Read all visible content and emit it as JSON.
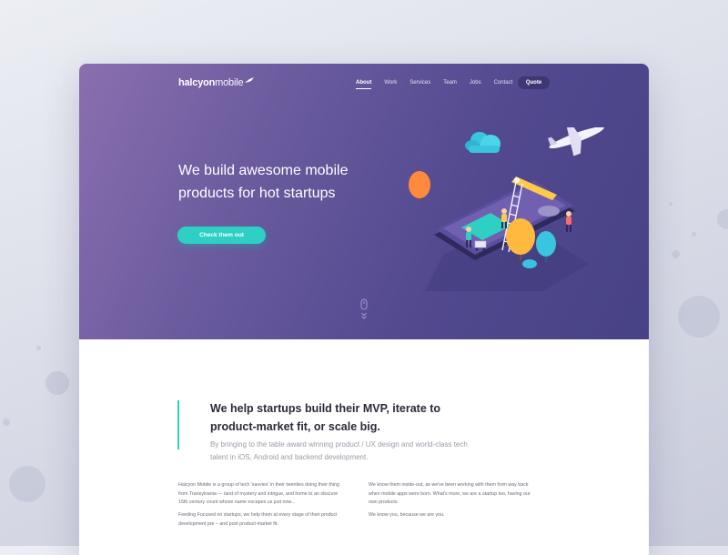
{
  "brand": {
    "name_bold": "halcyon",
    "name_light": "mobile"
  },
  "nav": {
    "items": [
      {
        "label": "About",
        "active": true
      },
      {
        "label": "Work",
        "active": false
      },
      {
        "label": "Services",
        "active": false
      },
      {
        "label": "Team",
        "active": false
      },
      {
        "label": "Jobs",
        "active": false
      },
      {
        "label": "Contact",
        "active": false
      }
    ],
    "quote_label": "Quote"
  },
  "hero": {
    "headline_line1": "We build awesome mobile",
    "headline_line2": "products for hot startups",
    "cta_label": "Check them out"
  },
  "intro": {
    "title_line1": "We help startups build their MVP, iterate to",
    "title_line2": "product-market fit, or scale big.",
    "subtitle_line1": "By bringing to the table award winning product / UX design and world-class tech",
    "subtitle_line2": "talent in iOS, Android and backend development."
  },
  "columns": {
    "left": {
      "p1_l1": "Halcyon Mobile is a group of tech 'savvies' in their twenties doing their thing",
      "p1_l2": "from Transylvania — land of mystery and intrigue, and home to an obscure",
      "p1_l3": "15th century count whose name escapes us just now...",
      "p2_l1": "Feeding Focused on startups, we help them at every stage of their product",
      "p2_l2": "development pre – and post product-market fit."
    },
    "right": {
      "p1_l1": "We know them inside-out, as we've been working with them from way back",
      "p1_l2": "when mobile apps were born. What's more, we are a startup too, having our",
      "p1_l3": "own products.",
      "p2_l1": "We know you, because we are you."
    }
  },
  "colors": {
    "accent": "#2ed0c4",
    "hero_start": "#8a6fb0",
    "hero_end": "#474285",
    "heading": "#2a2a3a"
  },
  "icons": [
    "bird-logo-icon",
    "cloud-icon",
    "airplane-icon",
    "mouse-scroll-icon",
    "chevron-down-icon"
  ]
}
